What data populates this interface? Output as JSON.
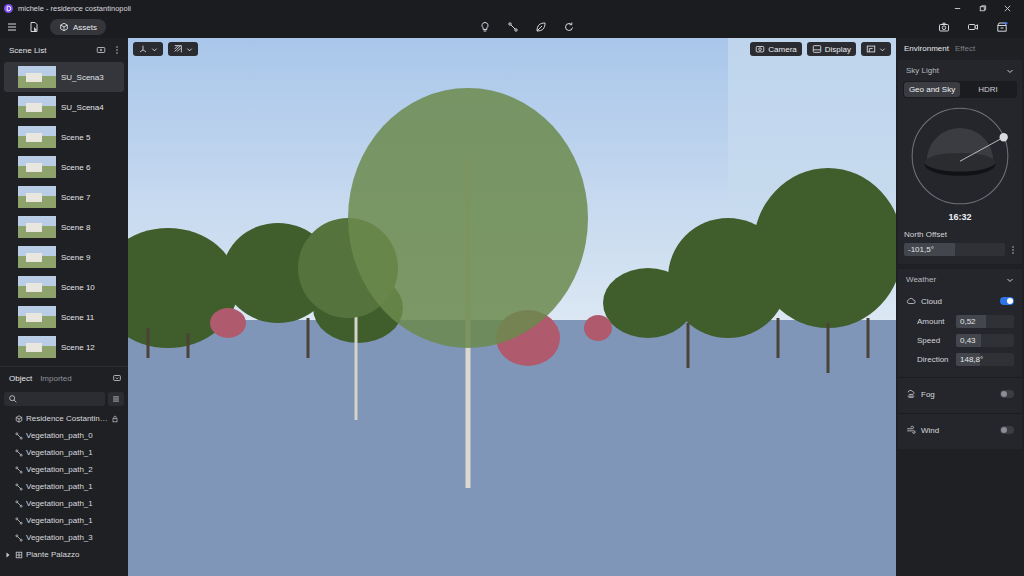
{
  "window": {
    "title": "michele - residence costantinopoli"
  },
  "toolbar": {
    "assets": "Assets"
  },
  "scene_list": {
    "title": "Scene List",
    "items": [
      {
        "name": "SU_Scena3",
        "selected": true
      },
      {
        "name": "SU_Scena4",
        "selected": false
      },
      {
        "name": "Scene 5",
        "selected": false
      },
      {
        "name": "Scene 6",
        "selected": false
      },
      {
        "name": "Scene 7",
        "selected": false
      },
      {
        "name": "Scene 8",
        "selected": false
      },
      {
        "name": "Scene 9",
        "selected": false
      },
      {
        "name": "Scene 10",
        "selected": false
      },
      {
        "name": "Scene 11",
        "selected": false
      },
      {
        "name": "Scene 12",
        "selected": false
      }
    ]
  },
  "object_panel": {
    "tabs": [
      {
        "label": "Object",
        "selected": true
      },
      {
        "label": "Imported",
        "selected": false
      }
    ],
    "items": [
      {
        "name": "Residence Costantin…",
        "kind": "model",
        "locked": true
      },
      {
        "name": "Vegetation_path_0",
        "kind": "path",
        "locked": false
      },
      {
        "name": "Vegetation_path_1",
        "kind": "path",
        "locked": false
      },
      {
        "name": "Vegetation_path_2",
        "kind": "path",
        "locked": false
      },
      {
        "name": "Vegetation_path_1",
        "kind": "path",
        "locked": false
      },
      {
        "name": "Vegetation_path_1",
        "kind": "path",
        "locked": false
      },
      {
        "name": "Vegetation_path_1",
        "kind": "path",
        "locked": false
      },
      {
        "name": "Vegetation_path_3",
        "kind": "path",
        "locked": false
      },
      {
        "name": "Piante Palazzo",
        "kind": "group",
        "locked": false,
        "expanded": false
      }
    ]
  },
  "viewport": {
    "buttons": [
      {
        "label": "Camera"
      },
      {
        "label": "Display"
      }
    ]
  },
  "environment": {
    "tabs": [
      {
        "label": "Environment",
        "selected": true
      },
      {
        "label": "Effect",
        "selected": false
      }
    ],
    "sky_light": {
      "title": "Sky Light",
      "expanded": true,
      "modes": [
        {
          "label": "Geo and Sky",
          "selected": true
        },
        {
          "label": "HDRI",
          "selected": false
        }
      ],
      "time": "16:32",
      "north_offset": {
        "label": "North Offset",
        "value": "-101,5°",
        "level": 0.5
      }
    },
    "weather": {
      "title": "Weather",
      "expanded": true,
      "items": [
        {
          "label": "Cloud",
          "kind": "toggle",
          "on": true
        },
        {
          "label": "Amount",
          "kind": "slider",
          "value": "0,52",
          "level": 0.52
        },
        {
          "label": "Speed",
          "kind": "slider",
          "value": "0,43",
          "level": 0.43
        },
        {
          "label": "Direction",
          "kind": "slider",
          "value": "148,8°",
          "level": 0.41
        },
        {
          "label": "Fog",
          "kind": "toggle",
          "on": false
        },
        {
          "label": "Wind",
          "kind": "toggle",
          "on": false
        }
      ]
    }
  }
}
